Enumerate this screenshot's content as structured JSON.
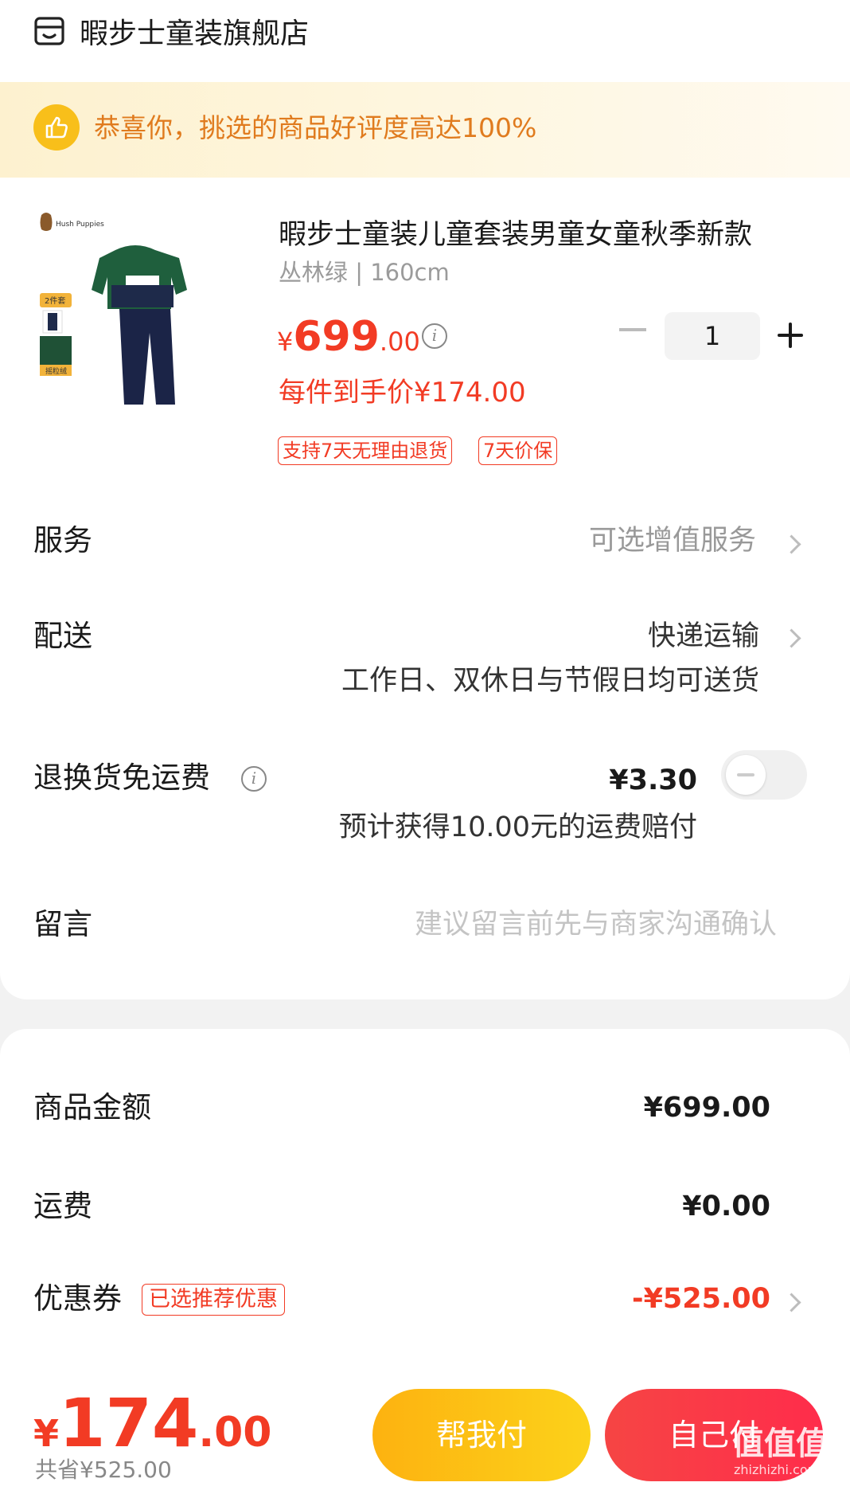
{
  "store": {
    "name": "暇步士童装旗舰店",
    "icon": "store-icon"
  },
  "banner": {
    "text": "恭喜你，挑选的商品好评度高达100%",
    "icon": "thumbs-up-icon"
  },
  "product": {
    "title": "暇步士童装儿童套装男童女童秋季新款",
    "spec": "丛林绿 | 160cm",
    "price_symbol": "¥",
    "price_int": "699",
    "price_dec": ".00",
    "quantity": "1",
    "unit_price": "每件到手价¥174.00",
    "tags": [
      "支持7天无理由退货",
      "7天价保"
    ],
    "image_brand": "Hush Puppies",
    "image_badge_set": "2件套",
    "image_badge_fleece": "摇粒绒"
  },
  "rows": {
    "service": {
      "label": "服务",
      "value": "可选增值服务"
    },
    "delivery": {
      "label": "配送",
      "value": "快递运输",
      "sub": "工作日、双休日与节假日均可送货"
    },
    "return_shipping": {
      "label": "退换货免运费",
      "value": "¥3.30",
      "sub": "预计获得10.00元的运费赔付",
      "toggle_on": false
    },
    "message": {
      "label": "留言",
      "placeholder": "建议留言前先与商家沟通确认"
    }
  },
  "summary": {
    "goods": {
      "label": "商品金额",
      "value": "¥699.00"
    },
    "freight": {
      "label": "运费",
      "value": "¥0.00"
    },
    "coupon": {
      "label": "优惠券",
      "badge": "已选推荐优惠",
      "value": "-¥525.00"
    }
  },
  "footer": {
    "total_symbol": "¥",
    "total_int": "174",
    "total_dec": ".00",
    "saved": "共省¥525.00",
    "help_pay": "帮我付",
    "self_pay": "自己付",
    "watermark": "值值值",
    "watermark_sub": "zhizhizhi.com"
  },
  "colors": {
    "accent_red": "#f23b24",
    "help_btn": "#fdb210",
    "self_btn": "#f64544",
    "banner_text": "#e07b1e"
  }
}
